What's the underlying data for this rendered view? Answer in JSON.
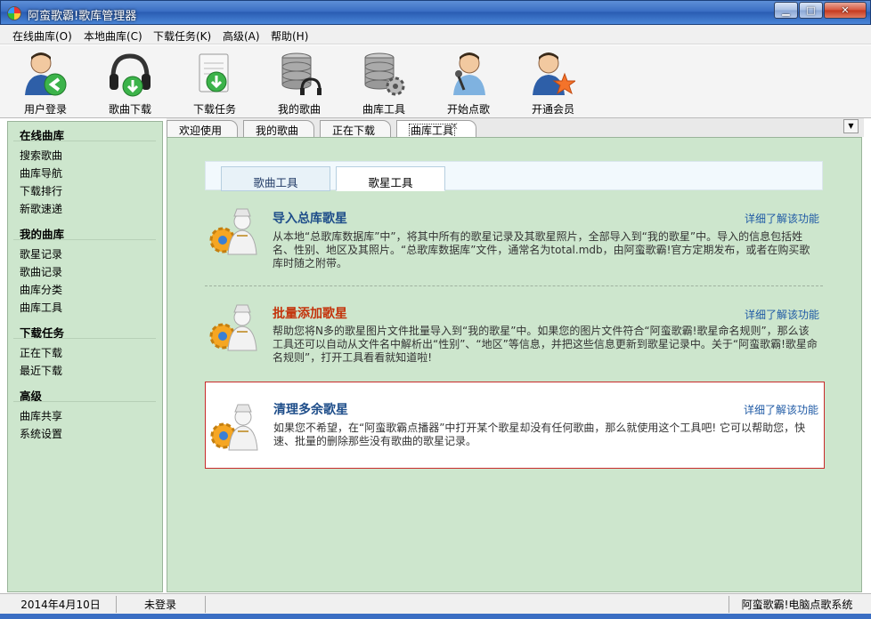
{
  "window": {
    "title": "阿蛮歌霸!歌库管理器",
    "controls": [
      "minimize-icon",
      "maximize-icon",
      "close-icon"
    ]
  },
  "menu": [
    "在线曲库(O)",
    "本地曲库(C)",
    "下载任务(K)",
    "高级(A)",
    "帮助(H)"
  ],
  "toolbar": [
    {
      "label": "用户登录",
      "icon": "user-login-icon"
    },
    {
      "label": "歌曲下载",
      "icon": "headphone-download-icon"
    },
    {
      "label": "下载任务",
      "icon": "download-task-icon"
    },
    {
      "label": "我的歌曲",
      "icon": "my-songs-database-icon"
    },
    {
      "label": "曲库工具",
      "icon": "library-tools-icon"
    },
    {
      "label": "开始点歌",
      "icon": "singer-microphone-icon"
    },
    {
      "label": "开通会员",
      "icon": "vip-member-icon"
    }
  ],
  "sidebar": {
    "sections": [
      {
        "heading": "在线曲库",
        "items": [
          "搜索歌曲",
          "曲库导航",
          "下载排行",
          "新歌速递"
        ]
      },
      {
        "heading": "我的曲库",
        "items": [
          "歌星记录",
          "歌曲记录",
          "曲库分类",
          "曲库工具"
        ]
      },
      {
        "heading": "下载任务",
        "items": [
          "正在下载",
          "最近下载"
        ]
      },
      {
        "heading": "高级",
        "items": [
          "曲库共享",
          "系统设置"
        ]
      }
    ]
  },
  "tabs": [
    "欢迎使用",
    "我的歌曲",
    "正在下载",
    "曲库工具"
  ],
  "active_tab": "曲库工具",
  "sub_tabs": [
    "歌曲工具",
    "歌星工具"
  ],
  "active_sub_tab": "歌星工具",
  "features": [
    {
      "title": "导入总库歌星",
      "link": "详细了解该功能",
      "desc": "从本地“总歌库数据库”中”，将其中所有的歌星记录及其歌星照片，全部导入到“我的歌星”中。导入的信息包括姓名、性别、地区及其照片。“总歌库数据库”文件，通常名为total.mdb，由阿蛮歌霸!官方定期发布，或者在购买歌库时随之附带。"
    },
    {
      "title": "批量添加歌星",
      "link": "详细了解该功能",
      "desc": "帮助您将N多的歌星图片文件批量导入到“我的歌星”中。如果您的图片文件符合“阿蛮歌霸!歌星命名规则”，那么该工具还可以自动从文件名中解析出“性别”、“地区”等信息，并把这些信息更新到歌星记录中。关于“阿蛮歌霸!歌星命名规则”，打开工具看看就知道啦!"
    },
    {
      "title": "清理多余歌星",
      "link": "详细了解该功能",
      "desc": "如果您不希望，在“阿蛮歌霸点播器”中打开某个歌星却没有任何歌曲，那么就使用这个工具吧! 它可以帮助您，快速、批量的删除那些没有歌曲的歌星记录。"
    }
  ],
  "status": {
    "date": "2014年4月10日",
    "login": "未登录",
    "app": "阿蛮歌霸!电脑点歌系统"
  },
  "colors": {
    "titlebar": "#3a6ec3",
    "panel_green": "#cde6cd",
    "feature_title_blue": "#1f4e8a",
    "feature_title_red": "#c3330b",
    "link_blue": "#1f5aa5",
    "selected_border": "#c82a2a"
  }
}
